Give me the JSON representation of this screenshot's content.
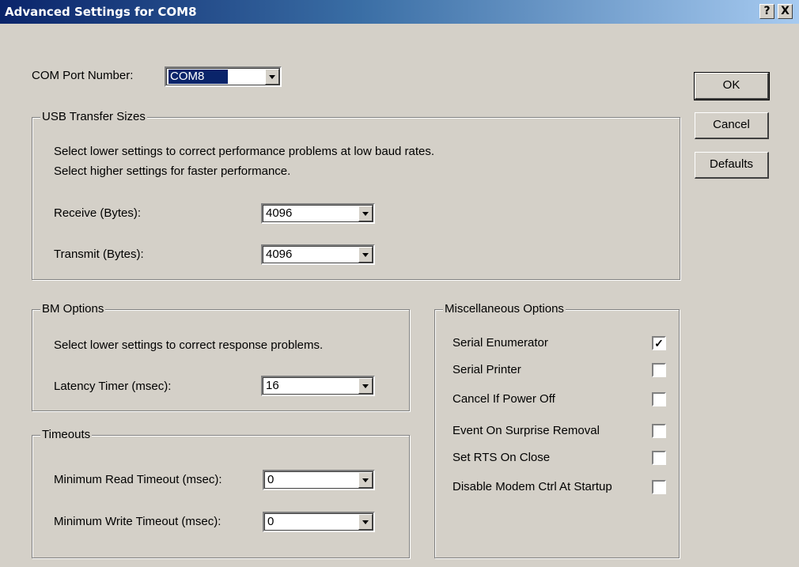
{
  "window": {
    "title": "Advanced Settings for COM8",
    "help_button": "?",
    "close_button": "X"
  },
  "com_port": {
    "label": "COM Port Number:",
    "value": "COM8"
  },
  "buttons": {
    "ok": "OK",
    "cancel": "Cancel",
    "defaults": "Defaults"
  },
  "usb_transfer": {
    "title": "USB Transfer Sizes",
    "desc_line1": "Select lower settings to correct performance problems at low baud rates.",
    "desc_line2": "Select higher settings for faster performance.",
    "receive_label": "Receive (Bytes):",
    "receive_value": "4096",
    "transmit_label": "Transmit (Bytes):",
    "transmit_value": "4096"
  },
  "bm_options": {
    "title": "BM Options",
    "desc": "Select lower settings to correct response problems.",
    "latency_label": "Latency Timer (msec):",
    "latency_value": "16"
  },
  "timeouts": {
    "title": "Timeouts",
    "read_label": "Minimum Read Timeout (msec):",
    "read_value": "0",
    "write_label": "Minimum Write Timeout (msec):",
    "write_value": "0"
  },
  "misc_options": {
    "title": "Miscellaneous Options",
    "items": [
      {
        "label": "Serial Enumerator",
        "checked": true,
        "mark": "✓"
      },
      {
        "label": "Serial Printer",
        "checked": false,
        "mark": ""
      },
      {
        "label": "Cancel If Power Off",
        "checked": false,
        "mark": ""
      },
      {
        "label": "Event On Surprise Removal",
        "checked": false,
        "mark": ""
      },
      {
        "label": "Set RTS On Close",
        "checked": false,
        "mark": ""
      },
      {
        "label": "Disable Modem Ctrl At Startup",
        "checked": false,
        "mark": ""
      }
    ]
  },
  "colors": {
    "title_bar_start": "#0a246a",
    "title_bar_end": "#a6caf0",
    "dialog_face": "#d4d0c8",
    "selection": "#0a246a"
  }
}
